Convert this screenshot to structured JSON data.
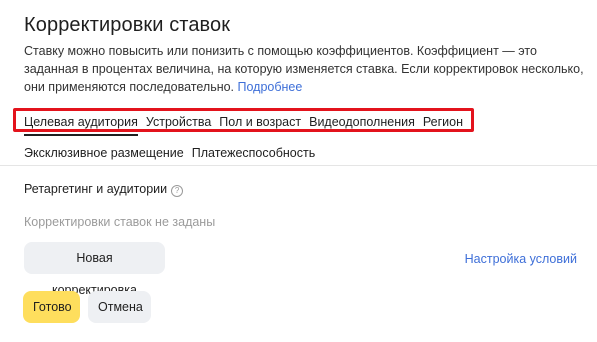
{
  "panel": {
    "title": "Корректировки ставок",
    "description": "Ставку можно повысить или понизить с помощью коэффициентов. Коэффициент — это заданная в процентах величина, на которую изменяется ставка. Если корректировок несколько, они применяются последовательно.",
    "more_link": "Подробнее"
  },
  "tabs": {
    "row1": [
      {
        "label": "Целевая аудитория",
        "active": true
      },
      {
        "label": "Устройства",
        "active": false
      },
      {
        "label": "Пол и возраст",
        "active": false
      },
      {
        "label": "Видеодополнения",
        "active": false
      },
      {
        "label": "Регион",
        "active": false
      }
    ],
    "row2": [
      {
        "label": "Эксклюзивное размещение",
        "active": false
      },
      {
        "label": "Платежеспособность",
        "active": false
      }
    ]
  },
  "section": {
    "title": "Ретаргетинг и аудитории",
    "help_icon": "?",
    "empty_text": "Корректировки ставок не заданы",
    "new_button": "Новая корректировка",
    "settings_link": "Настройка условий"
  },
  "footer": {
    "done_button": "Готово",
    "cancel_button": "Отмена"
  },
  "colors": {
    "accent_yellow": "#fede5d",
    "link_blue": "#3e6fd8",
    "highlight_red": "#e3131c",
    "button_gray": "#eef0f3"
  }
}
